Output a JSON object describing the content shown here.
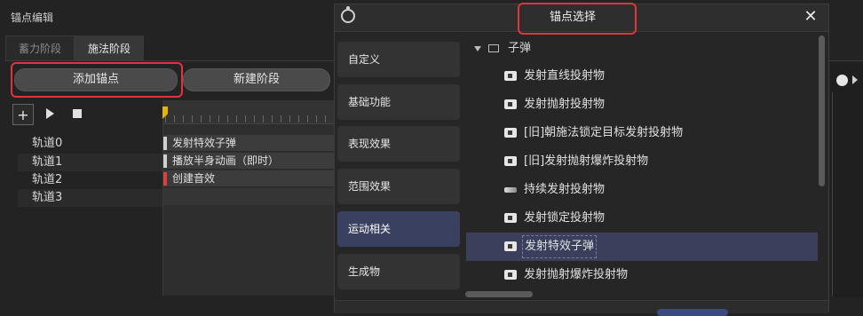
{
  "editor": {
    "title": "锚点编辑",
    "tabs": [
      {
        "label": "蓄力阶段"
      },
      {
        "label": "施法阶段"
      }
    ],
    "add_anchor_label": "添加锚点",
    "new_stage_label": "新建阶段",
    "tools": {
      "plus": "+"
    },
    "tracks": [
      {
        "label": "轨道0",
        "clip": "发射特效子弹"
      },
      {
        "label": "轨道1",
        "clip": "播放半身动画（即时）"
      },
      {
        "label": "轨道2",
        "clip": "创建音效"
      },
      {
        "label": "轨道3",
        "clip": ""
      }
    ]
  },
  "dialog": {
    "title": "锚点选择",
    "close_glyph": "✕",
    "categories": [
      {
        "label": "自定义"
      },
      {
        "label": "基础功能"
      },
      {
        "label": "表现效果"
      },
      {
        "label": "范围效果"
      },
      {
        "label": "运动相关"
      },
      {
        "label": "生成物"
      }
    ],
    "active_category": "运动相关",
    "tree": {
      "folder_label": "子弹",
      "items": [
        {
          "label": "发射直线投射物",
          "icon": "projectile-icon"
        },
        {
          "label": "发射抛射投射物",
          "icon": "projectile-icon"
        },
        {
          "label": "[旧]朝施法锁定目标发射投射物",
          "icon": "projectile-icon"
        },
        {
          "label": "[旧]发射抛射爆炸投射物",
          "icon": "projectile-icon"
        },
        {
          "label": "持续发射投射物",
          "icon": "beam-icon"
        },
        {
          "label": "发射锁定投射物",
          "icon": "projectile-icon"
        },
        {
          "label": "发射特效子弹",
          "icon": "projectile-icon"
        },
        {
          "label": "发射抛射爆炸投射物",
          "icon": "projectile-icon"
        }
      ],
      "selected": "发射特效子弹"
    }
  },
  "colors": {
    "highlight": "#e0343f",
    "selection": "#3b3f5c",
    "active_category": "#3a4060",
    "playhead": "#e7b400"
  }
}
